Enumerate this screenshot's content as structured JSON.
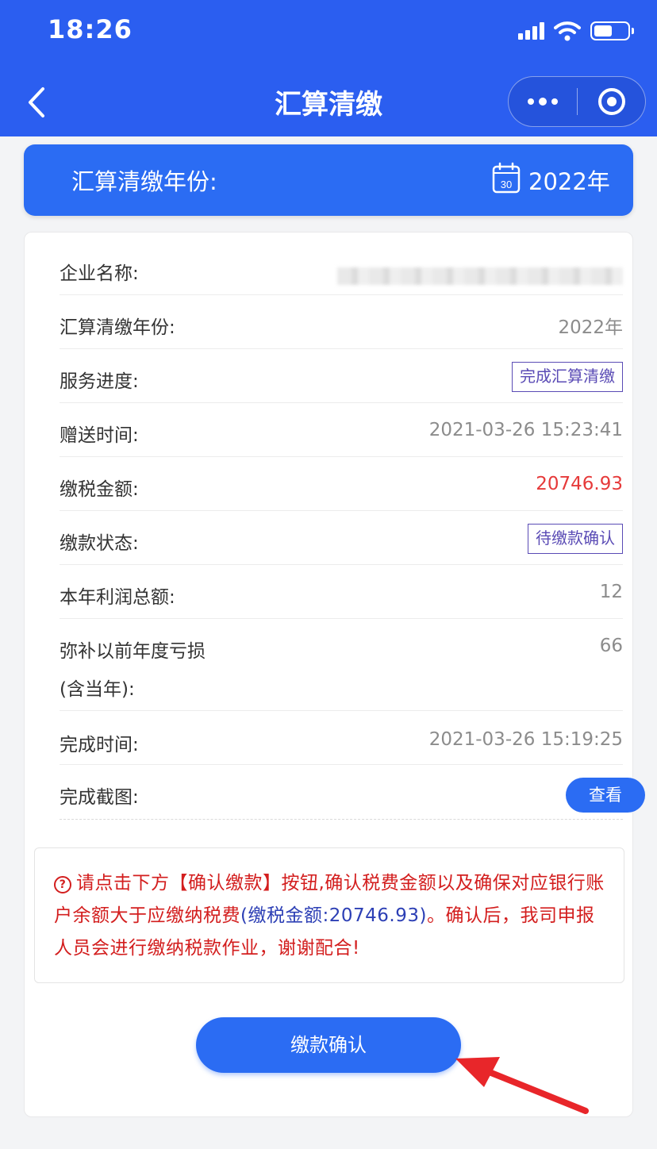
{
  "status_bar": {
    "time": "18:26"
  },
  "nav": {
    "title": "汇算清缴"
  },
  "year_bar": {
    "label": "汇算清缴年份:",
    "calendar_day": "30",
    "value": "2022年"
  },
  "rows": [
    {
      "key": "企业名称:",
      "value": ""
    },
    {
      "key": "汇算清缴年份:",
      "value": "2022年"
    },
    {
      "key": "服务进度:",
      "value": "完成汇算清缴"
    },
    {
      "key": "赠送时间:",
      "value": "2021-03-26 15:23:41"
    },
    {
      "key": "缴税金额:",
      "value": "20746.93"
    },
    {
      "key": "缴款状态:",
      "value": "待缴款确认"
    },
    {
      "key": "本年利润总额:",
      "value": "12"
    },
    {
      "key": "弥补以前年度亏损",
      "key2": "(含当年):",
      "value": "66"
    },
    {
      "key": "完成时间:",
      "value": "2021-03-26 15:19:25"
    },
    {
      "key": "完成截图:",
      "value": "查看"
    }
  ],
  "notice": {
    "icon": "?",
    "part1": "请点击下方【确认缴款】按钮,确认税费金额以及确保对应银行账户余额大于应缴纳税费",
    "part2": "(缴税金额:20746.93)",
    "part3": "。确认后，我司申报人员会进行缴纳税款作业，谢谢配合!"
  },
  "pay_button": {
    "label": "缴款确认"
  },
  "colors": {
    "header": "#2b5ef0",
    "accent": "#2b6cf3",
    "amount": "#e63a3a",
    "notice": "#d31e1e",
    "tag": "#5a4bb5"
  }
}
